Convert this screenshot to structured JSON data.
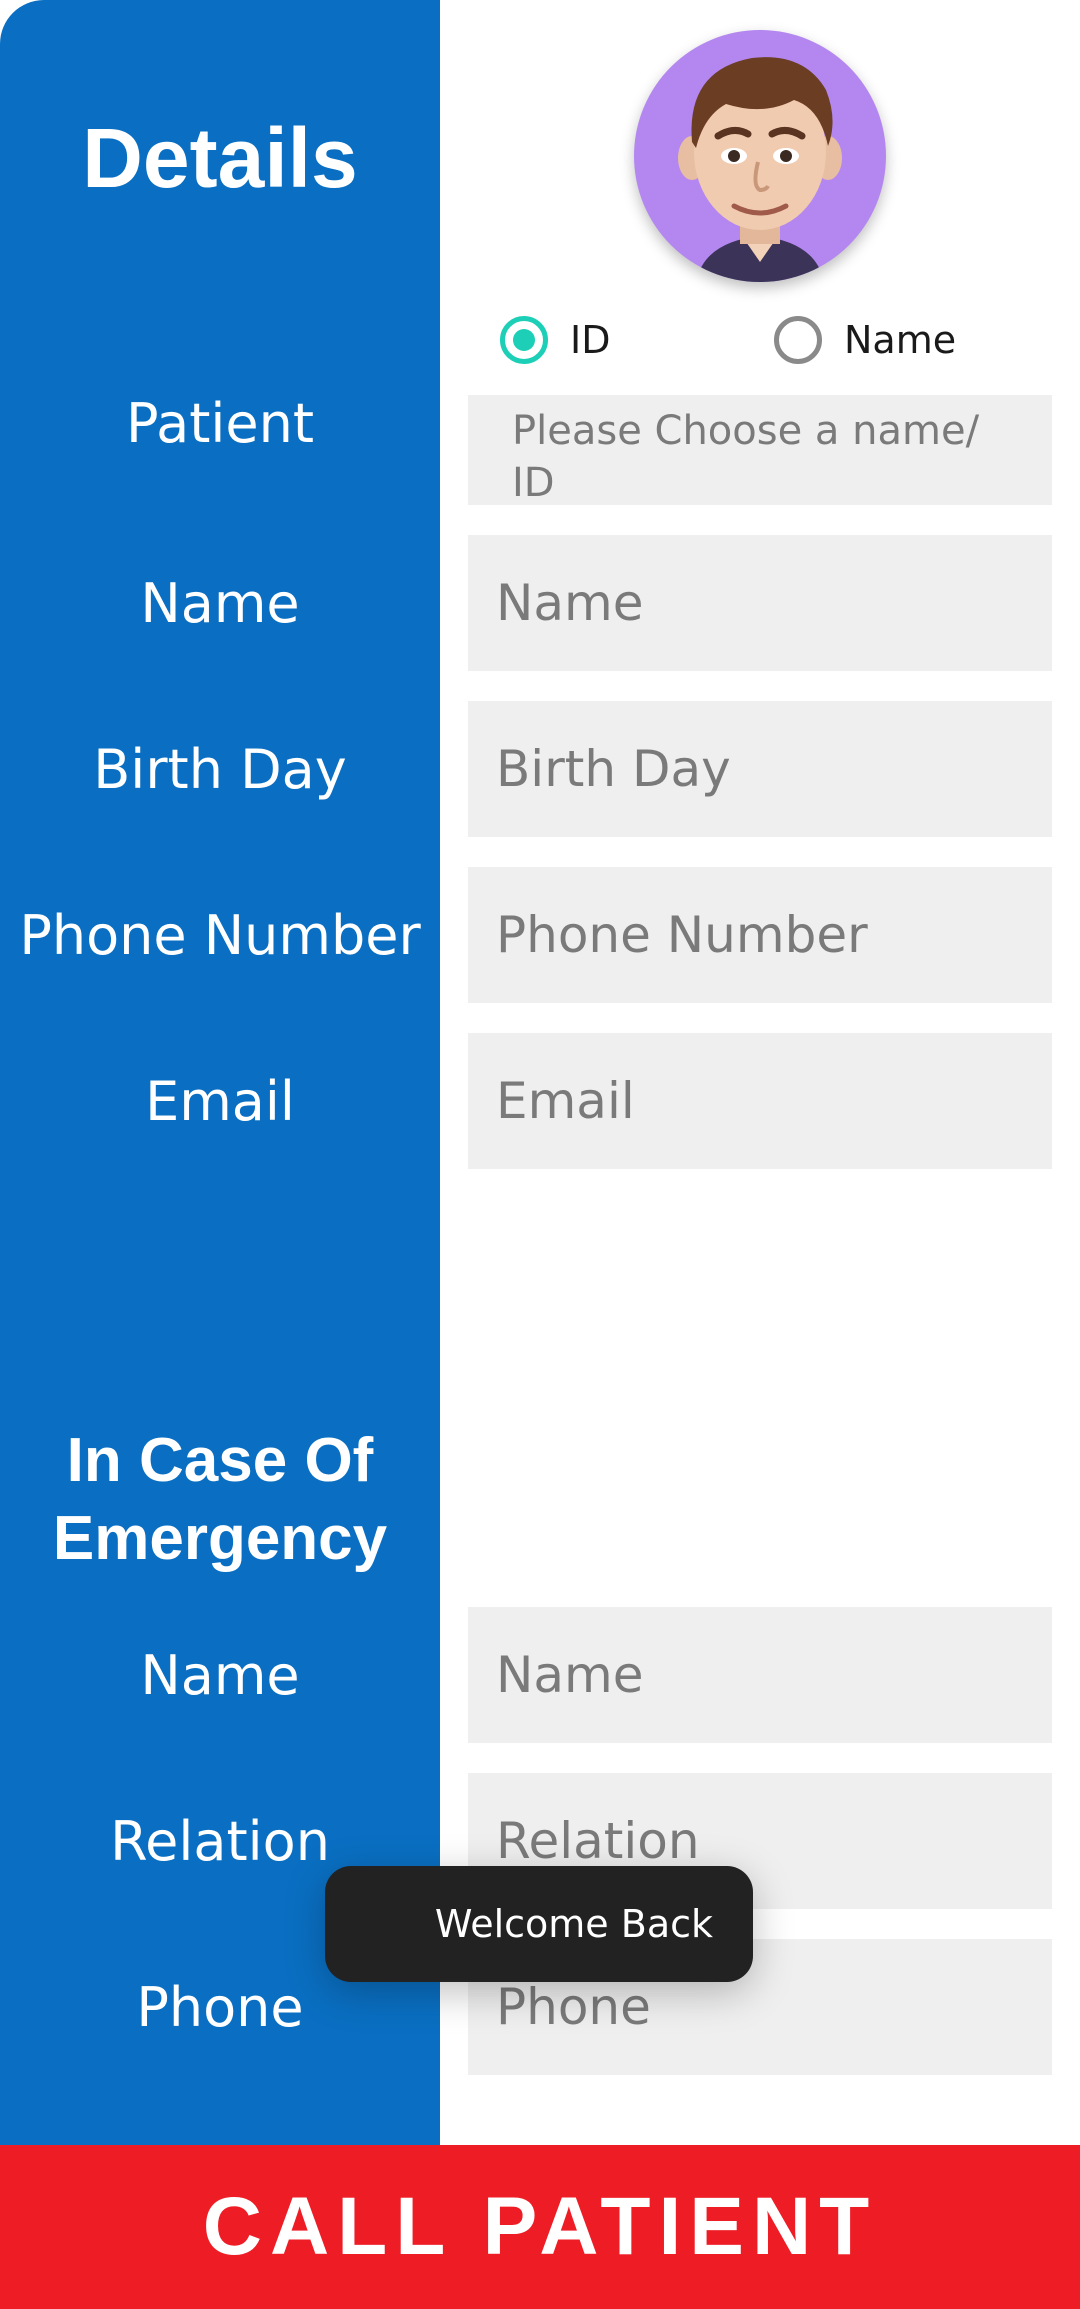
{
  "sidebar": {
    "details_title": "Details",
    "emergency_title": "In Case Of Emergency",
    "labels": {
      "patient": "Patient",
      "name": "Name",
      "birthday": "Birth Day",
      "phone_number": "Phone Number",
      "email": "Email",
      "ice_name": "Name",
      "ice_relation": "Relation",
      "ice_phone": "Phone"
    }
  },
  "search_mode": {
    "options": [
      {
        "label": "ID",
        "selected": true
      },
      {
        "label": "Name",
        "selected": false
      }
    ]
  },
  "fields": {
    "patient_select_placeholder": "Please Choose a name/ ID",
    "name_placeholder": "Name",
    "birthday_placeholder": "Birth Day",
    "phone_placeholder": "Phone Number",
    "email_placeholder": "Email",
    "ice_name_placeholder": "Name",
    "ice_relation_placeholder": "Relation",
    "ice_phone_placeholder": "Phone"
  },
  "toast": {
    "message": "Welcome Back"
  },
  "call_button": {
    "label": "CALL PATIENT"
  },
  "colors": {
    "sidebar": "#0a6fc2",
    "accent_radio": "#1ccfb6",
    "call_button": "#ee1c25",
    "avatar_background": "#b487f0",
    "field_background": "#efefef"
  }
}
